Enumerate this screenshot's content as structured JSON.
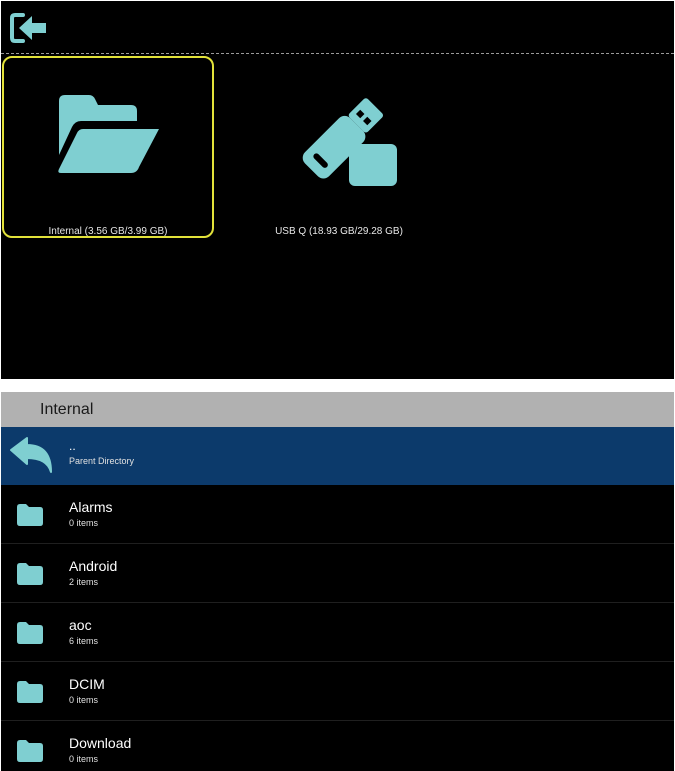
{
  "colors": {
    "icon": "#7fcfd1",
    "selection": "#e2e23a",
    "parent_row": "#0c3a6b",
    "header_bar": "#b1b1b1"
  },
  "top": {
    "exit_icon": "exit-icon",
    "storages": [
      {
        "icon": "folder-open-icon",
        "label": "Internal (3.56 GB/3.99 GB)",
        "selected": true
      },
      {
        "icon": "usb-drive-icon",
        "label": "USB Q (18.93 GB/29.28 GB)",
        "selected": false
      }
    ]
  },
  "browser": {
    "title": "Internal",
    "parent": {
      "icon": "back-arrow-icon",
      "name": "..",
      "subtitle": "Parent Directory"
    },
    "items": [
      {
        "icon": "folder-icon",
        "name": "Alarms",
        "count": "0 items"
      },
      {
        "icon": "folder-icon",
        "name": "Android",
        "count": "2 items"
      },
      {
        "icon": "folder-icon",
        "name": "aoc",
        "count": "6 items"
      },
      {
        "icon": "folder-icon",
        "name": "DCIM",
        "count": "0 items"
      },
      {
        "icon": "folder-icon",
        "name": "Download",
        "count": "0 items"
      }
    ]
  }
}
